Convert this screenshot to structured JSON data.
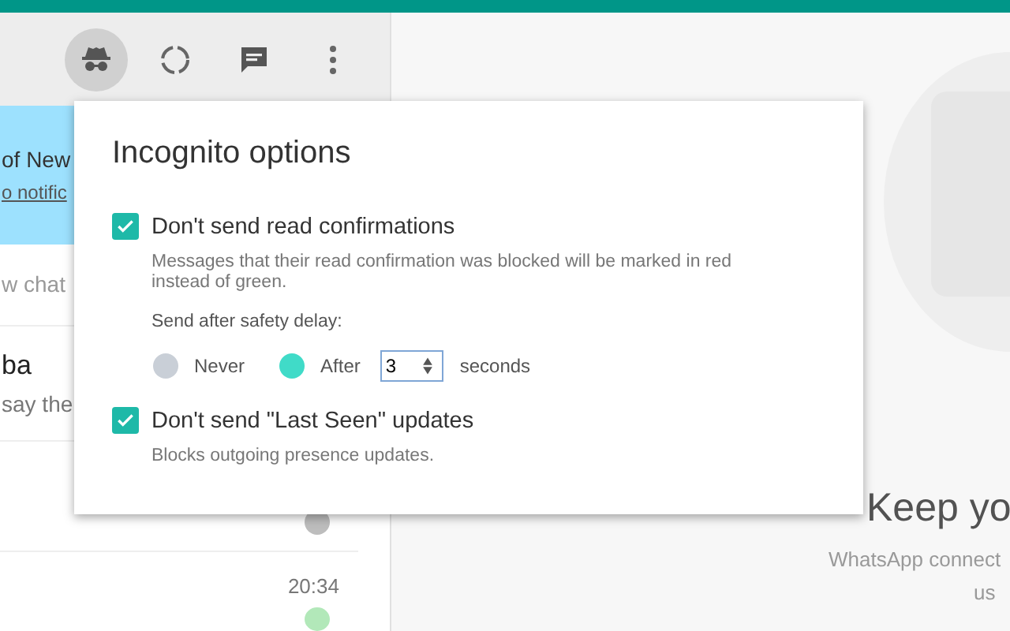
{
  "header_icons": [
    {
      "kind": "incognito",
      "selected": true
    },
    {
      "kind": "status",
      "selected": false
    },
    {
      "kind": "chat",
      "selected": false
    },
    {
      "kind": "menu",
      "selected": false
    }
  ],
  "notification": {
    "title": "of New",
    "link": "o notific"
  },
  "search": {
    "placeholder": "w chat"
  },
  "chats": [
    {
      "name": "ba",
      "preview": "say the"
    },
    {
      "color": "#bdbdbd"
    },
    {
      "time": "20:34",
      "color": "#b2e8b9"
    }
  ],
  "welcome": {
    "title": "Keep yo",
    "lines": [
      "WhatsApp connect",
      "us"
    ]
  },
  "popup": {
    "title": "Incognito options",
    "options": [
      {
        "label": "Don't send read confirmations",
        "checked": true,
        "description": "Messages that their read confirmation was blocked will be marked in red instead of green.",
        "delay": {
          "label": "Send after safety delay:",
          "choices": [
            {
              "label": "Never",
              "selected": false
            },
            {
              "label": "After",
              "selected": true
            }
          ],
          "value": "3",
          "unit": "seconds"
        }
      },
      {
        "label": "Don't send \"Last Seen\" updates",
        "checked": true,
        "description": "Blocks outgoing presence updates."
      }
    ]
  }
}
